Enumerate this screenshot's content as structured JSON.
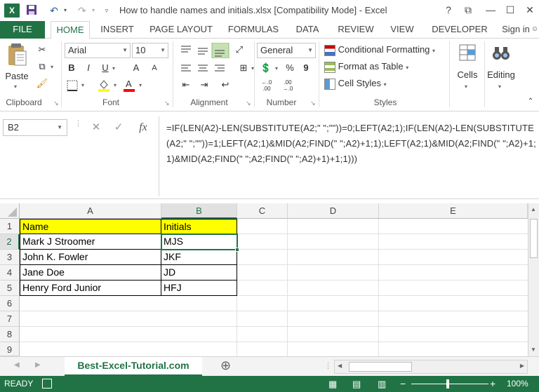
{
  "titlebar": {
    "app_icon": "X",
    "title": "How to handle names and initials.xlsx  [Compatibility Mode] - Excel",
    "help": "?",
    "restore": "⧉",
    "minimize": "—",
    "maximize": "☐",
    "close": "✕"
  },
  "tabs": {
    "file": "FILE",
    "home": "HOME",
    "insert": "INSERT",
    "page_layout": "PAGE LAYOUT",
    "formulas": "FORMULAS",
    "data": "DATA",
    "review": "REVIEW",
    "view": "VIEW",
    "developer": "DEVELOPER",
    "sign_in": "Sign in"
  },
  "ribbon": {
    "clipboard": {
      "label": "Clipboard",
      "paste": "Paste"
    },
    "font": {
      "label": "Font",
      "font_name": "Arial",
      "font_size": "10",
      "bold": "B",
      "italic": "I",
      "underline": "U",
      "grow": "A",
      "shrink": "A"
    },
    "alignment": {
      "label": "Alignment"
    },
    "number": {
      "label": "Number",
      "format": "General",
      "percent": "%",
      "comma": "9"
    },
    "styles": {
      "label": "Styles",
      "conditional": "Conditional Formatting",
      "format_table": "Format as Table",
      "cell_styles": "Cell Styles"
    },
    "cells": {
      "label": "Cells"
    },
    "editing": {
      "label": "Editing"
    }
  },
  "formula_bar": {
    "name_box": "B2",
    "cancel": "✕",
    "enter": "✓",
    "fx": "fx",
    "formula": "=IF(LEN(A2)-LEN(SUBSTITUTE(A2;\" \";\"\"))=0;LEFT(A2;1);IF(LEN(A2)-LEN(SUBSTITUTE(A2;\" \";\"\"))=1;LEFT(A2;1)&MID(A2;FIND(\" \";A2)+1;1);LEFT(A2;1)&MID(A2;FIND(\" \";A2)+1;1)&MID(A2;FIND(\" \";A2;FIND(\" \";A2)+1)+1;1)))"
  },
  "grid": {
    "columns": [
      "A",
      "B",
      "C",
      "D",
      "E"
    ],
    "rows": [
      "1",
      "2",
      "3",
      "4",
      "5",
      "6",
      "7",
      "8",
      "9"
    ],
    "cells": [
      [
        "Name",
        "Initials"
      ],
      [
        "Mark J Stroomer",
        "MJS"
      ],
      [
        "John K. Fowler",
        "JKF"
      ],
      [
        "Jane Doe",
        "JD"
      ],
      [
        "Henry Ford Junior",
        "HFJ"
      ]
    ]
  },
  "sheets": {
    "active": "Best-Excel-Tutorial.com",
    "add": "⊕"
  },
  "statusbar": {
    "ready": "READY",
    "zoom": "100%",
    "minus": "−",
    "plus": "+"
  },
  "colors": {
    "excel_green": "#217346",
    "header_yellow": "#ffff00"
  }
}
